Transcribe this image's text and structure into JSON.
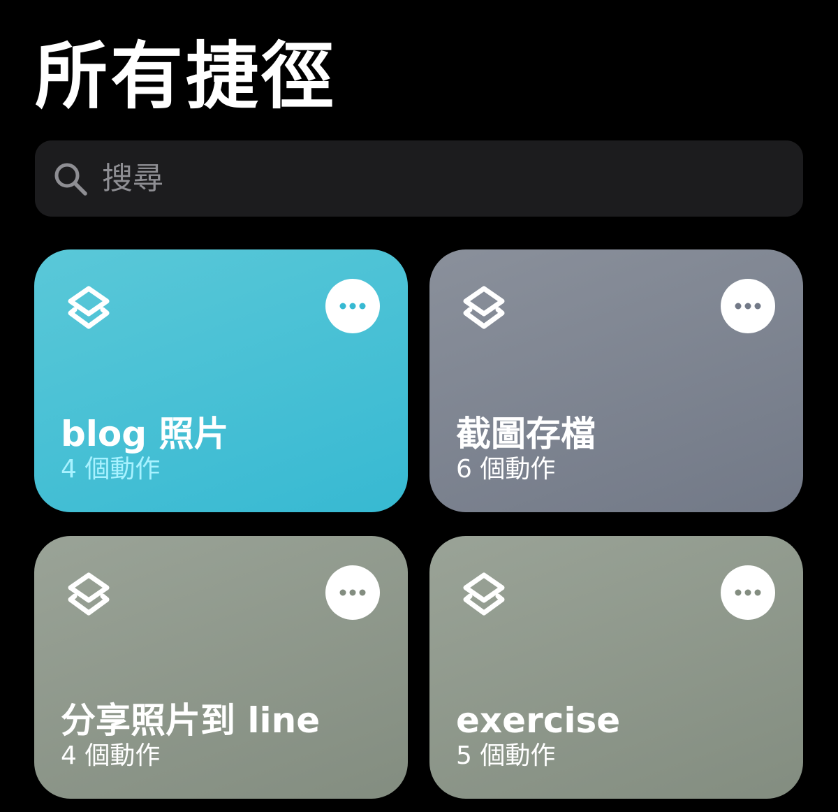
{
  "header": {
    "title": "所有捷徑"
  },
  "search": {
    "placeholder": "搜尋",
    "value": ""
  },
  "shortcuts": [
    {
      "name": "blog 照片",
      "count": "4 個動作",
      "icon": "layers-icon",
      "gradient_start": "#5ac8d8",
      "gradient_end": "#37b9d2",
      "count_color": "#a8f2ff"
    },
    {
      "name": "截圖存檔",
      "count": "6 個動作",
      "icon": "layers-icon",
      "gradient_start": "#8a909b",
      "gradient_end": "#727987",
      "count_color": "#ffffff"
    },
    {
      "name": "分享照片到 line",
      "count": "4 個動作",
      "icon": "layers-icon",
      "gradient_start": "#9aa397",
      "gradient_end": "#838d80",
      "count_color": "#ffffff"
    },
    {
      "name": "exercise",
      "count": "5 個動作",
      "icon": "layers-icon",
      "gradient_start": "#9aa397",
      "gradient_end": "#838d80",
      "count_color": "#ffffff"
    }
  ],
  "more_icon": "ellipsis-icon"
}
